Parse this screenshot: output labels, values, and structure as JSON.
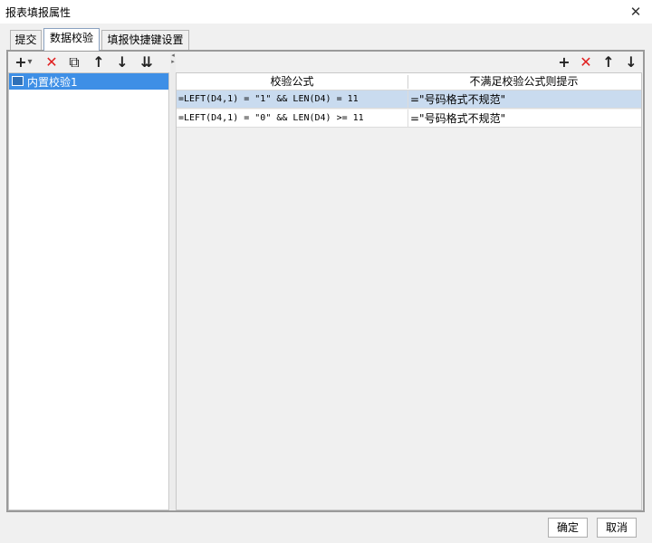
{
  "window": {
    "title": "报表填报属性",
    "close_symbol": "✕"
  },
  "tabs": [
    {
      "label": "提交",
      "active": false
    },
    {
      "label": "数据校验",
      "active": true
    },
    {
      "label": "填报快捷键设置",
      "active": false
    }
  ],
  "left_toolbar": {
    "add": "+",
    "add_dropdown": "▾",
    "delete": "✕",
    "copy": "⧉",
    "up": "↑",
    "down": "↓",
    "move_bottom": "⇊"
  },
  "left_list": {
    "items": [
      {
        "label": "内置校验1",
        "selected": true
      }
    ]
  },
  "splitter": {
    "arrows": "◂▸"
  },
  "right_toolbar": {
    "add": "+",
    "delete": "✕",
    "up": "↑",
    "down": "↓"
  },
  "grid": {
    "headers": [
      "校验公式",
      "不满足校验公式则提示"
    ],
    "rows": [
      {
        "formula": "=LEFT(D4,1) = \"1\" && LEN(D4) = 11",
        "message": "=\"号码格式不规范\"",
        "selected": true
      },
      {
        "formula": "=LEFT(D4,1) = \"0\" && LEN(D4) >= 11",
        "message": "=\"号码格式不规范\"",
        "selected": false
      }
    ]
  },
  "buttons": {
    "ok": "确定",
    "cancel": "取消"
  },
  "colors": {
    "selection": "#3e8fe6",
    "row_selected": "#c9dbef",
    "delete_red": "#e02020"
  }
}
